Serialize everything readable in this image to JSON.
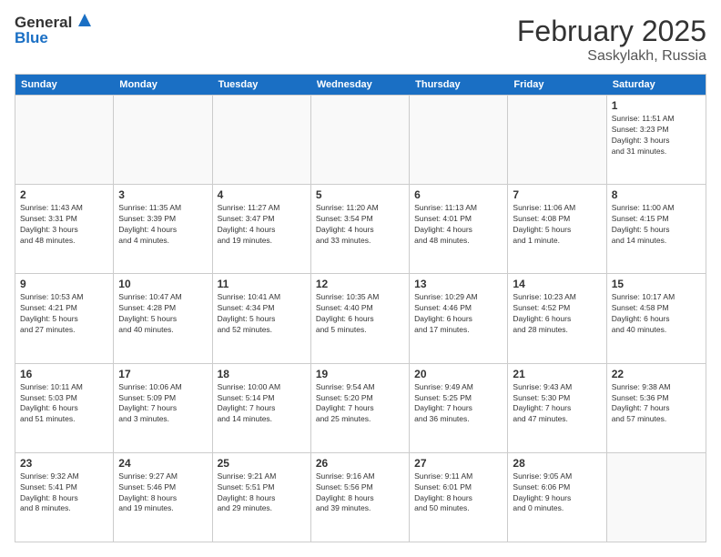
{
  "logo": {
    "line1": "General",
    "line2": "Blue"
  },
  "header": {
    "month": "February 2025",
    "location": "Saskylakh, Russia"
  },
  "weekdays": [
    "Sunday",
    "Monday",
    "Tuesday",
    "Wednesday",
    "Thursday",
    "Friday",
    "Saturday"
  ],
  "weeks": [
    [
      {
        "day": "",
        "info": ""
      },
      {
        "day": "",
        "info": ""
      },
      {
        "day": "",
        "info": ""
      },
      {
        "day": "",
        "info": ""
      },
      {
        "day": "",
        "info": ""
      },
      {
        "day": "",
        "info": ""
      },
      {
        "day": "1",
        "info": "Sunrise: 11:51 AM\nSunset: 3:23 PM\nDaylight: 3 hours\nand 31 minutes."
      }
    ],
    [
      {
        "day": "2",
        "info": "Sunrise: 11:43 AM\nSunset: 3:31 PM\nDaylight: 3 hours\nand 48 minutes."
      },
      {
        "day": "3",
        "info": "Sunrise: 11:35 AM\nSunset: 3:39 PM\nDaylight: 4 hours\nand 4 minutes."
      },
      {
        "day": "4",
        "info": "Sunrise: 11:27 AM\nSunset: 3:47 PM\nDaylight: 4 hours\nand 19 minutes."
      },
      {
        "day": "5",
        "info": "Sunrise: 11:20 AM\nSunset: 3:54 PM\nDaylight: 4 hours\nand 33 minutes."
      },
      {
        "day": "6",
        "info": "Sunrise: 11:13 AM\nSunset: 4:01 PM\nDaylight: 4 hours\nand 48 minutes."
      },
      {
        "day": "7",
        "info": "Sunrise: 11:06 AM\nSunset: 4:08 PM\nDaylight: 5 hours\nand 1 minute."
      },
      {
        "day": "8",
        "info": "Sunrise: 11:00 AM\nSunset: 4:15 PM\nDaylight: 5 hours\nand 14 minutes."
      }
    ],
    [
      {
        "day": "9",
        "info": "Sunrise: 10:53 AM\nSunset: 4:21 PM\nDaylight: 5 hours\nand 27 minutes."
      },
      {
        "day": "10",
        "info": "Sunrise: 10:47 AM\nSunset: 4:28 PM\nDaylight: 5 hours\nand 40 minutes."
      },
      {
        "day": "11",
        "info": "Sunrise: 10:41 AM\nSunset: 4:34 PM\nDaylight: 5 hours\nand 52 minutes."
      },
      {
        "day": "12",
        "info": "Sunrise: 10:35 AM\nSunset: 4:40 PM\nDaylight: 6 hours\nand 5 minutes."
      },
      {
        "day": "13",
        "info": "Sunrise: 10:29 AM\nSunset: 4:46 PM\nDaylight: 6 hours\nand 17 minutes."
      },
      {
        "day": "14",
        "info": "Sunrise: 10:23 AM\nSunset: 4:52 PM\nDaylight: 6 hours\nand 28 minutes."
      },
      {
        "day": "15",
        "info": "Sunrise: 10:17 AM\nSunset: 4:58 PM\nDaylight: 6 hours\nand 40 minutes."
      }
    ],
    [
      {
        "day": "16",
        "info": "Sunrise: 10:11 AM\nSunset: 5:03 PM\nDaylight: 6 hours\nand 51 minutes."
      },
      {
        "day": "17",
        "info": "Sunrise: 10:06 AM\nSunset: 5:09 PM\nDaylight: 7 hours\nand 3 minutes."
      },
      {
        "day": "18",
        "info": "Sunrise: 10:00 AM\nSunset: 5:14 PM\nDaylight: 7 hours\nand 14 minutes."
      },
      {
        "day": "19",
        "info": "Sunrise: 9:54 AM\nSunset: 5:20 PM\nDaylight: 7 hours\nand 25 minutes."
      },
      {
        "day": "20",
        "info": "Sunrise: 9:49 AM\nSunset: 5:25 PM\nDaylight: 7 hours\nand 36 minutes."
      },
      {
        "day": "21",
        "info": "Sunrise: 9:43 AM\nSunset: 5:30 PM\nDaylight: 7 hours\nand 47 minutes."
      },
      {
        "day": "22",
        "info": "Sunrise: 9:38 AM\nSunset: 5:36 PM\nDaylight: 7 hours\nand 57 minutes."
      }
    ],
    [
      {
        "day": "23",
        "info": "Sunrise: 9:32 AM\nSunset: 5:41 PM\nDaylight: 8 hours\nand 8 minutes."
      },
      {
        "day": "24",
        "info": "Sunrise: 9:27 AM\nSunset: 5:46 PM\nDaylight: 8 hours\nand 19 minutes."
      },
      {
        "day": "25",
        "info": "Sunrise: 9:21 AM\nSunset: 5:51 PM\nDaylight: 8 hours\nand 29 minutes."
      },
      {
        "day": "26",
        "info": "Sunrise: 9:16 AM\nSunset: 5:56 PM\nDaylight: 8 hours\nand 39 minutes."
      },
      {
        "day": "27",
        "info": "Sunrise: 9:11 AM\nSunset: 6:01 PM\nDaylight: 8 hours\nand 50 minutes."
      },
      {
        "day": "28",
        "info": "Sunrise: 9:05 AM\nSunset: 6:06 PM\nDaylight: 9 hours\nand 0 minutes."
      },
      {
        "day": "",
        "info": ""
      }
    ]
  ]
}
